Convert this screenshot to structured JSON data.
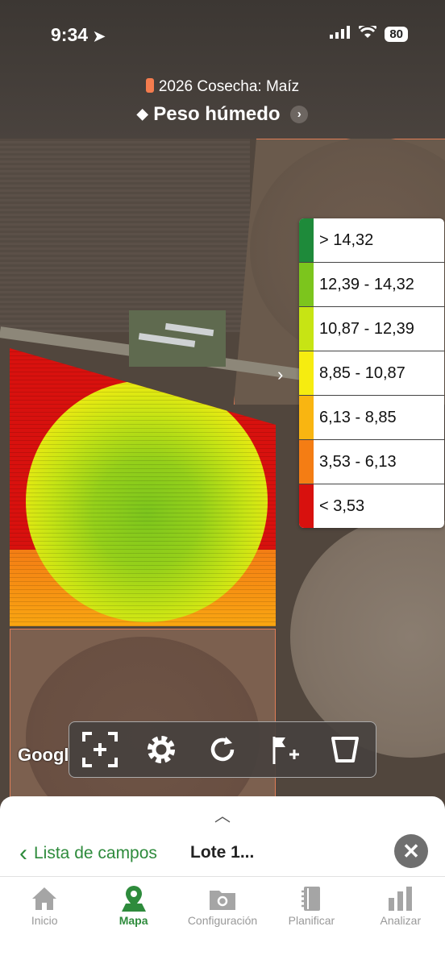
{
  "status": {
    "time": "9:34",
    "battery": "80"
  },
  "header": {
    "season": "2026 Cosecha: Maíz",
    "layer": "Peso húmedo"
  },
  "legend": {
    "items": [
      {
        "label": "> 14,32",
        "color": "#1e8a3a"
      },
      {
        "label": "12,39 - 14,32",
        "color": "#7cc51d"
      },
      {
        "label": "10,87 - 12,39",
        "color": "#c7e414"
      },
      {
        "label": "8,85 - 10,87",
        "color": "#f6ec10"
      },
      {
        "label": "6,13 - 8,85",
        "color": "#f9b511"
      },
      {
        "label": "3,53 - 6,13",
        "color": "#f47d14"
      },
      {
        "label": "< 3,53",
        "color": "#d8110e"
      }
    ]
  },
  "map": {
    "attribution": "Googl"
  },
  "toolbar": {
    "tools": [
      {
        "icon": "focus-add-icon"
      },
      {
        "icon": "gear-icon"
      },
      {
        "icon": "refresh-icon"
      },
      {
        "icon": "flag-add-icon"
      },
      {
        "icon": "boundary-icon"
      }
    ]
  },
  "sheet": {
    "back_label": "Lista de campos",
    "field_name": "Lote 1..."
  },
  "tabs": [
    {
      "label": "Inicio",
      "icon": "home-icon",
      "active": false
    },
    {
      "label": "Mapa",
      "icon": "map-pin-icon",
      "active": true
    },
    {
      "label": "Configuración",
      "icon": "folder-gear-icon",
      "active": false
    },
    {
      "label": "Planificar",
      "icon": "notebook-icon",
      "active": false
    },
    {
      "label": "Analizar",
      "icon": "bar-chart-icon",
      "active": false
    }
  ],
  "colors": {
    "accent": "#2e8b3c"
  }
}
